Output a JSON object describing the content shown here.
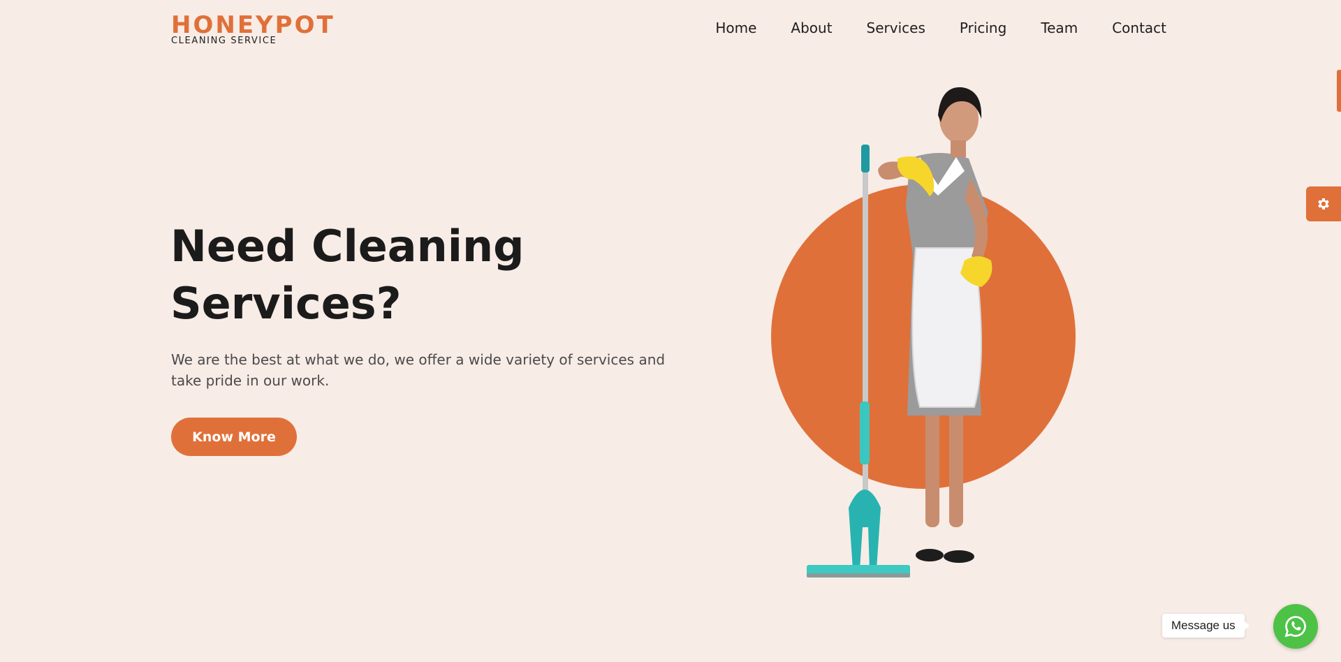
{
  "brand": {
    "name": "HONEYPOT",
    "tagline": "CLEANING SERVICE",
    "accent_color": "#e07039",
    "background_color": "#f8ece6"
  },
  "nav": {
    "items": [
      {
        "label": "Home"
      },
      {
        "label": "About"
      },
      {
        "label": "Services"
      },
      {
        "label": "Pricing"
      },
      {
        "label": "Team"
      },
      {
        "label": "Contact"
      }
    ]
  },
  "hero": {
    "title": "Need Cleaning Services?",
    "description": "We are the best at what we do, we offer a wide variety of services and take pride in our work.",
    "cta_label": "Know More",
    "image_icon": "cleaning-lady-with-mop-illustration"
  },
  "widgets": {
    "settings_icon": "gear-icon",
    "message_label": "Message us",
    "whatsapp_icon": "whatsapp-icon",
    "whatsapp_color": "#4dc247"
  }
}
